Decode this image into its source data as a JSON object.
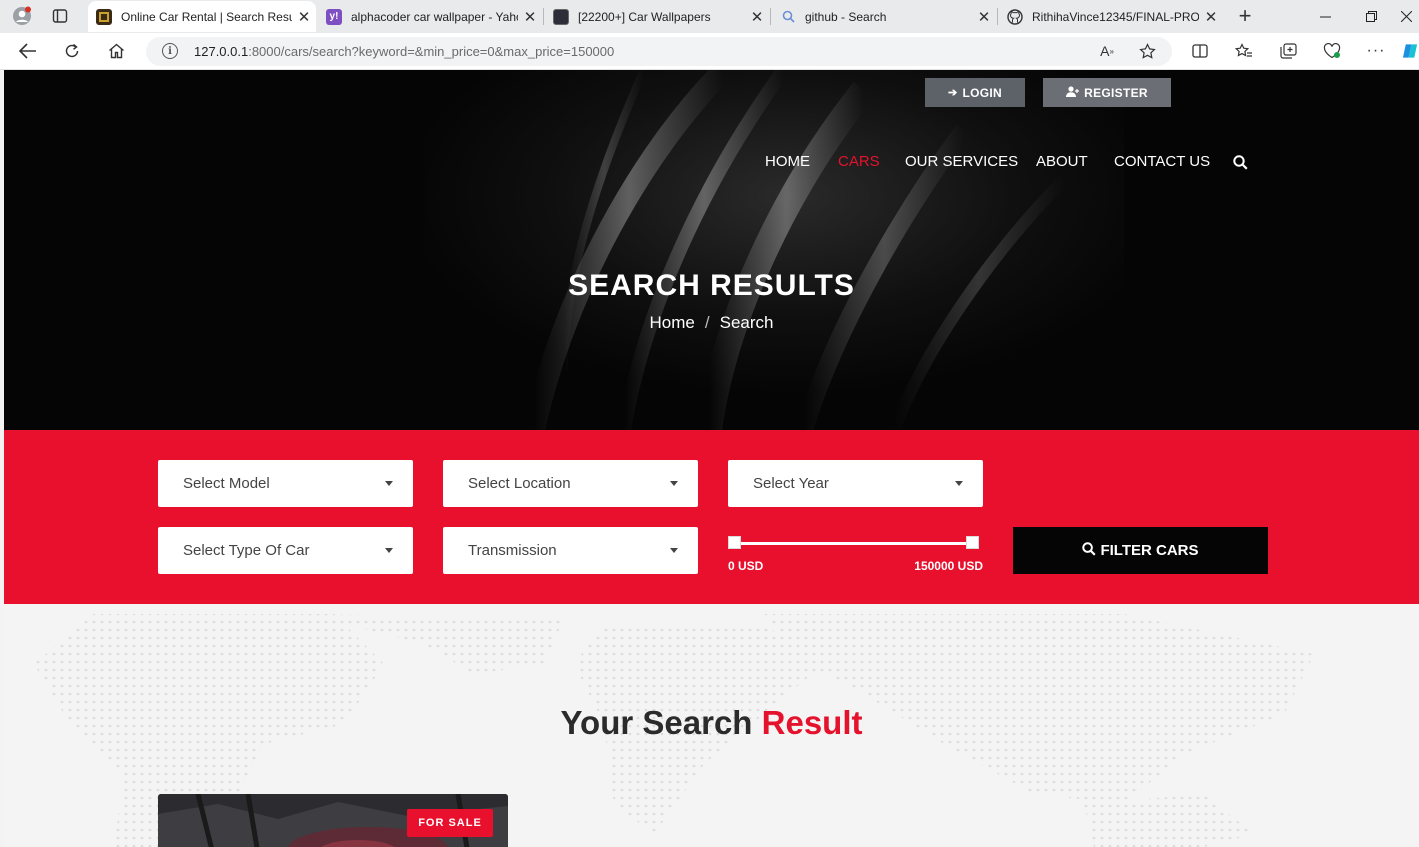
{
  "browser": {
    "tabs": [
      {
        "title": "Online Car Rental | Search Results",
        "favicon": "app-logo-icon",
        "active": true
      },
      {
        "title": "alphacoder car wallpaper - Yahoo Search",
        "favicon": "yahoo-icon",
        "active": false
      },
      {
        "title": "[22200+] Car Wallpapers",
        "favicon": "wallpaper-site-icon",
        "active": false
      },
      {
        "title": "github - Search",
        "favicon": "search-icon",
        "active": false
      },
      {
        "title": "RithihaVince12345/FINAL-PROJECT",
        "favicon": "github-icon",
        "active": false
      }
    ],
    "url_host": "127.0.0.1",
    "url_rest": ":8000/cars/search?keyword=&min_price=0&max_price=150000"
  },
  "header": {
    "login_label": "LOGIN",
    "register_label": "REGISTER",
    "nav": [
      {
        "label": "HOME",
        "active": false
      },
      {
        "label": "CARS",
        "active": true
      },
      {
        "label": "OUR SERVICES",
        "active": false
      },
      {
        "label": "ABOUT",
        "active": false
      },
      {
        "label": "CONTACT US",
        "active": false
      }
    ]
  },
  "hero": {
    "title": "SEARCH RESULTS",
    "breadcrumb": [
      "Home",
      "Search"
    ],
    "breadcrumb_separator": "/"
  },
  "filters": {
    "model_placeholder": "Select Model",
    "location_placeholder": "Select Location",
    "year_placeholder": "Select Year",
    "type_placeholder": "Select Type Of Car",
    "transmission_placeholder": "Transmission",
    "price_min_label": "0 USD",
    "price_max_label": "150000 USD",
    "price_min": 0,
    "price_max": 150000,
    "filter_button": "FILTER CARS"
  },
  "results": {
    "title_prefix": "Your Search",
    "title_accent": "Result",
    "cards": [
      {
        "badge": "FOR SALE"
      }
    ]
  },
  "colors": {
    "accent": "#e8102c",
    "hero_bg": "#050505"
  }
}
